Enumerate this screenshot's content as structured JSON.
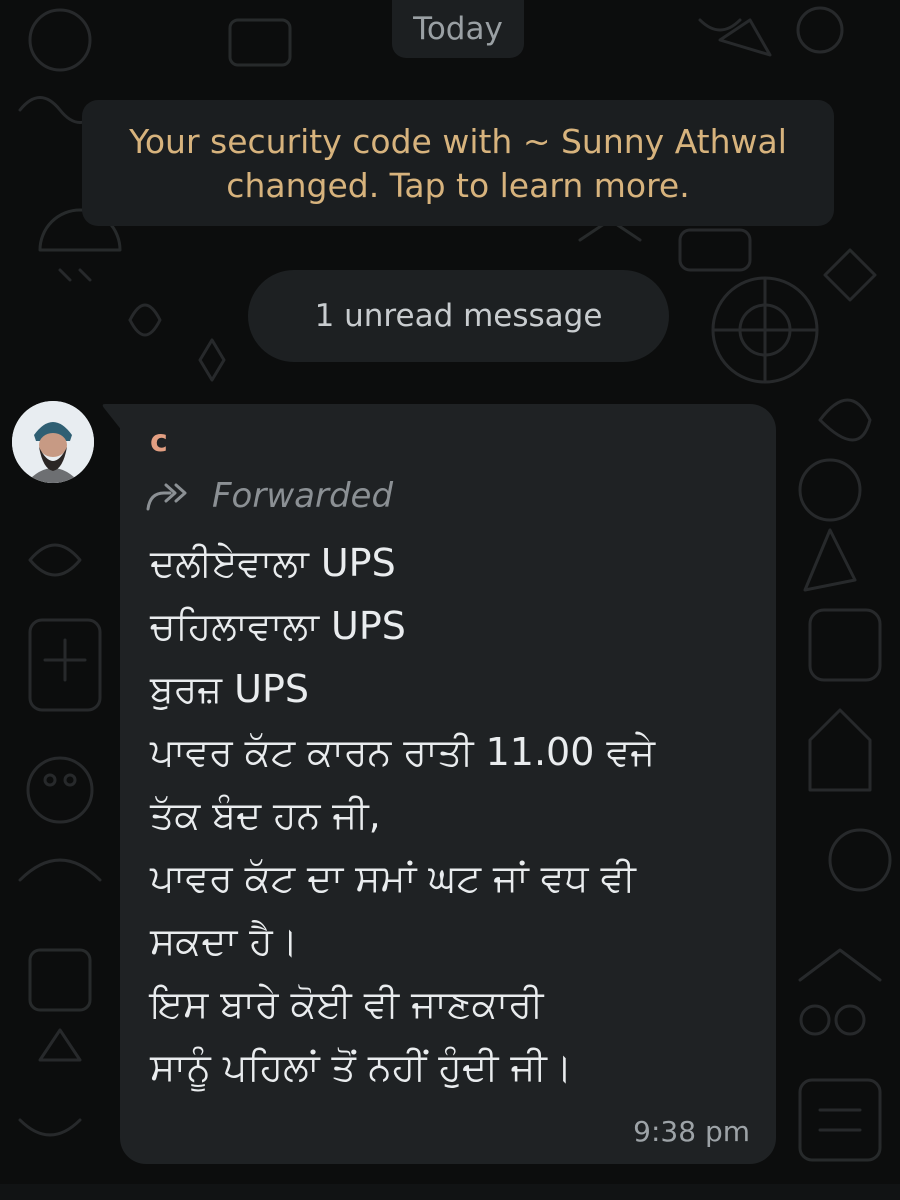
{
  "chat": {
    "date_chip": "Today",
    "security_notice": {
      "line1": "Your security code with ~ Sunny Athwal",
      "line2": "changed. Tap to learn more."
    },
    "unread_banner": "1 unread message"
  },
  "message": {
    "sender_name": "c",
    "forwarded_label": "Forwarded",
    "lines": [
      "ਦਲੀਏਵਾਲਾ UPS",
      "ਚਹਿਲਾਵਾਲਾ UPS",
      "ਬੁਰਜ਼ UPS",
      "ਪਾਵਰ ਕੱਟ ਕਾਰਨ ਰਾਤੀ 11.00 ਵਜੇ",
      "ਤੱਕ ਬੰਦ ਹਨ ਜੀ,",
      "ਪਾਵਰ ਕੱਟ ਦਾ ਸਮਾਂ ਘਟ ਜਾਂ ਵਧ ਵੀ",
      "ਸਕਦਾ ਹੈ।",
      "ਇਸ ਬਾਰੇ ਕੋਈ ਵੀ ਜਾਣਕਾਰੀ",
      "ਸਾਨੂੰ ਪਹਿਲਾਂ ਤੋਂ ਨਹੀਂ ਹੁੰਦੀ ਜੀ।"
    ],
    "time": "9:38 pm"
  },
  "icons": {
    "avatar": "avatar-icon",
    "forward": "forward-icon"
  },
  "colors": {
    "bubble_bg": "#1f2224",
    "notice_text": "#d7b37d",
    "sender_name": "#e29f82",
    "message_text": "#e9ecee"
  }
}
